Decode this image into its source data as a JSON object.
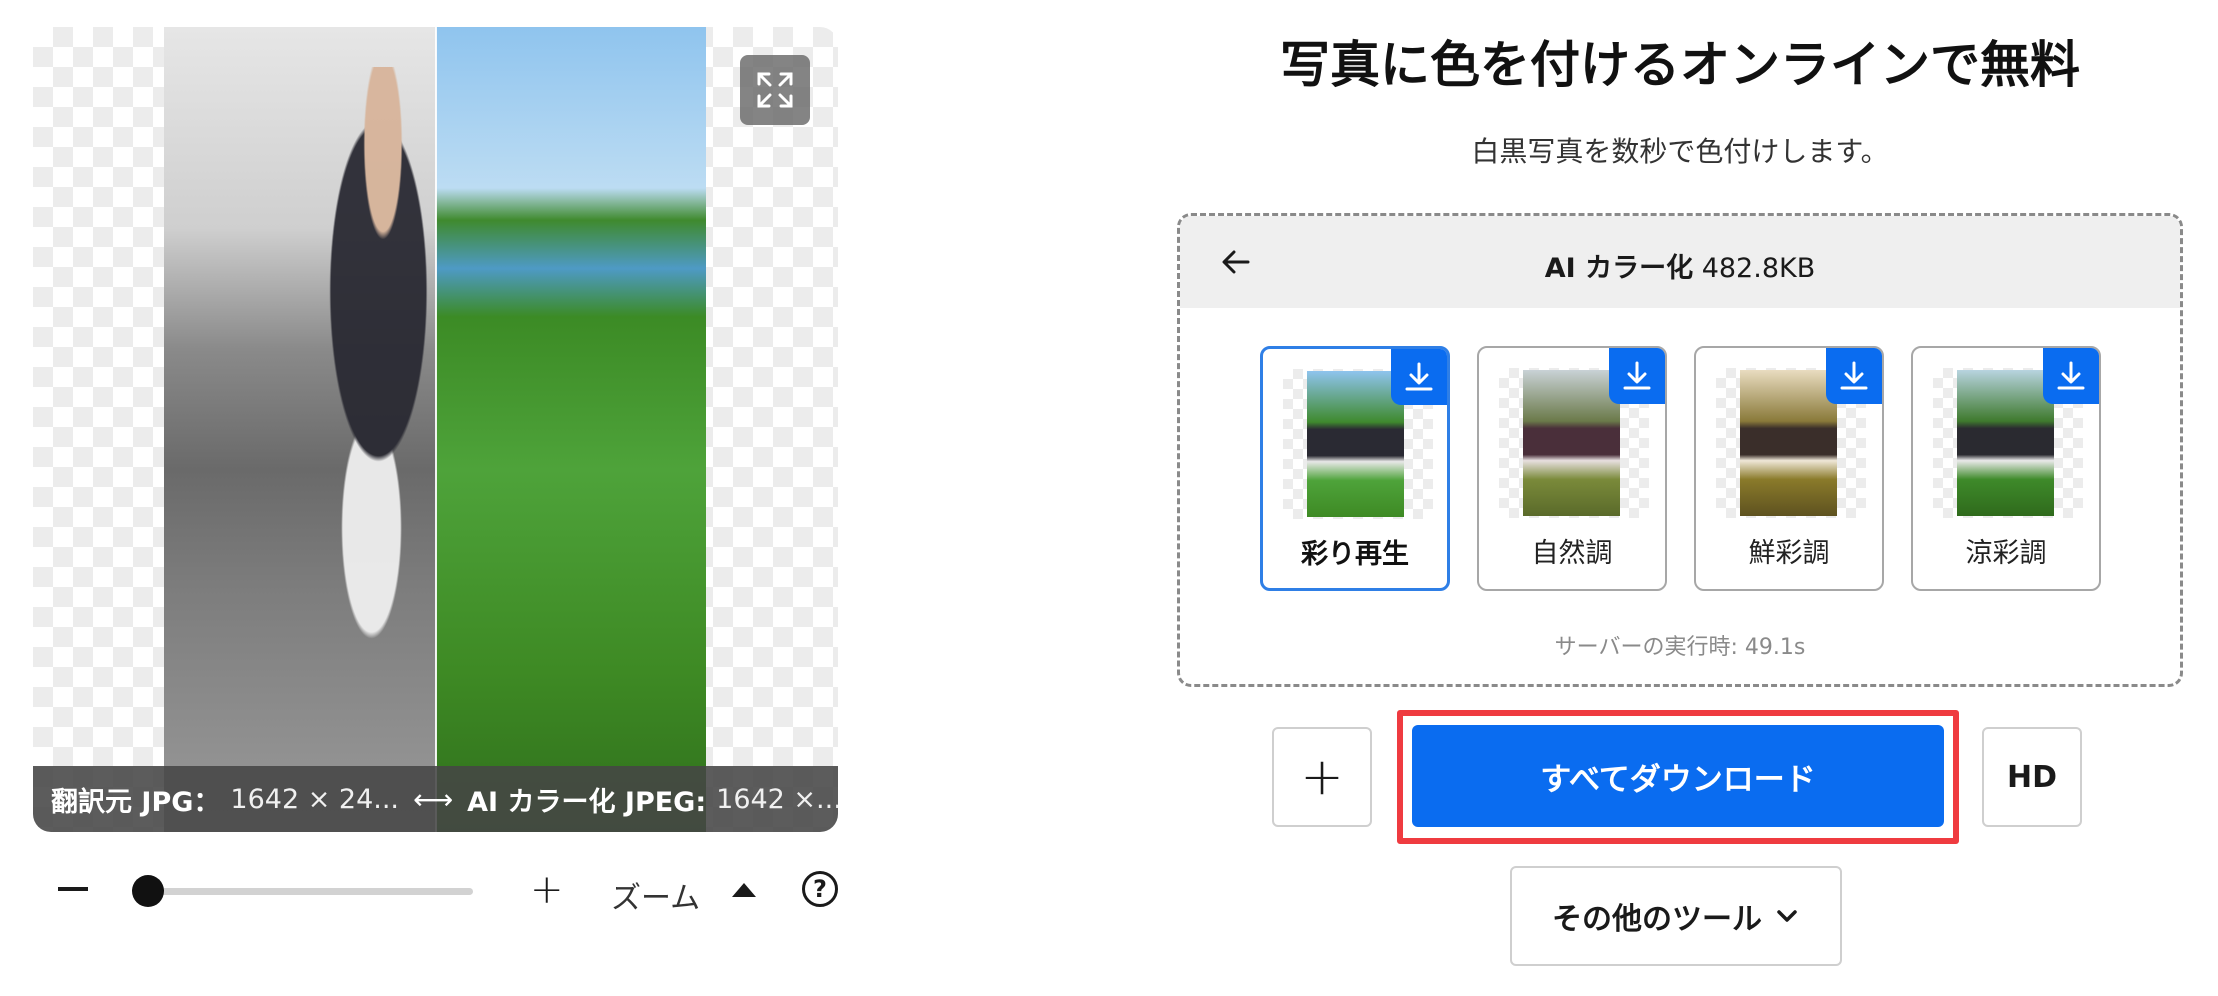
{
  "preview": {
    "original_label": "翻訳元 JPG：",
    "original_size": "1642 × 24...",
    "colorized_label": "AI カラー化 JPEG:",
    "colorized_size": "1642 ×...",
    "compare_arrow": "⟷"
  },
  "zoom": {
    "label": "ズーム",
    "level": 0.1
  },
  "page": {
    "title": "写真に色を付けるオンラインで無料",
    "subtitle": "白黒写真を数秒で色付けします。"
  },
  "panel": {
    "tool_name": "AI カラー化",
    "file_size": "482.8KB",
    "server_time": "サーバーの実行時: 49.1s",
    "variants": [
      {
        "label": "彩り再生",
        "selected": true
      },
      {
        "label": "自然調",
        "selected": false
      },
      {
        "label": "鮮彩調",
        "selected": false
      },
      {
        "label": "涼彩調",
        "selected": false
      }
    ]
  },
  "actions": {
    "add_label": "+",
    "download_all_label": "すべてダウンロード",
    "hd_label": "HD",
    "other_tools_label": "その他のツール"
  },
  "colors": {
    "accent": "#0a6cf0",
    "highlight": "#ef3b40",
    "selected_border": "#2f7fe6"
  }
}
